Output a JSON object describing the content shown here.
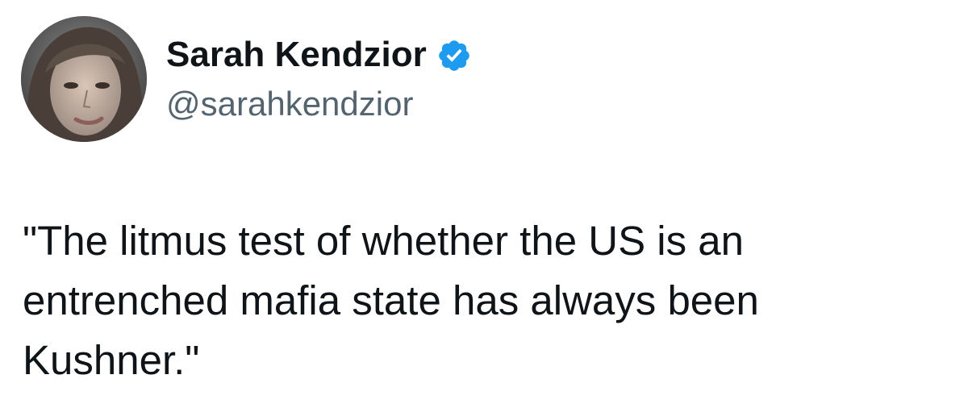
{
  "author": {
    "display_name": "Sarah Kendzior",
    "handle": "@sarahkendzior",
    "verified": true,
    "badge_icon": "verified-check-icon",
    "badge_color": "#1d9bf0"
  },
  "tweet": {
    "text": "\"The litmus test of whether the US is an\nentrenched mafia state has always been\nKushner.\""
  },
  "colors": {
    "text_primary": "#0f1419",
    "text_secondary": "#536471",
    "background": "#ffffff"
  }
}
